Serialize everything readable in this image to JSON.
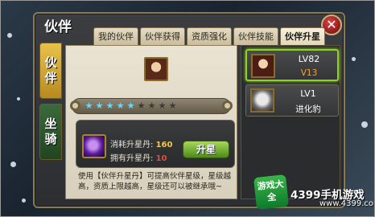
{
  "panel": {
    "title": "伙伴"
  },
  "tabs": [
    "我的伙伴",
    "伙伴获得",
    "资质强化",
    "伙伴技能",
    "伙伴升星"
  ],
  "side_tabs": [
    {
      "line1": "伙",
      "line2": "伴",
      "active": true
    },
    {
      "line1": "坐",
      "line2": "骑",
      "active": false
    }
  ],
  "star_bar": {
    "lit_stars": 5,
    "total_stars": 9
  },
  "upgrade": {
    "cost_label": "消耗升星丹:",
    "cost_value": "160",
    "own_label": "拥有升星丹:",
    "own_value": "10",
    "button_label": "升星"
  },
  "description": "使用【伙伴升星丹】可提高伙伴星级，星级越高，资质上限越高，星级还可以被继承哦~",
  "companions": [
    {
      "level": "LV82",
      "sub": "V13",
      "sub_color": "#f2a23a",
      "selected": true,
      "avatar": "female-warrior-portrait"
    },
    {
      "level": "LV1",
      "sub": "进化豹",
      "sub_color": "#ffffff",
      "selected": false,
      "avatar": "white-leopard-portrait"
    }
  ],
  "icons": {
    "close": "close-icon",
    "item": "star-pill-icon"
  },
  "watermark": {
    "badge": "游戏大全",
    "text": "4399手机游戏",
    "url": "www.4399.com"
  },
  "colors": {
    "active_green": "#8fd41c",
    "cost_value": "#f4c84a",
    "own_value": "#e84a3a"
  }
}
